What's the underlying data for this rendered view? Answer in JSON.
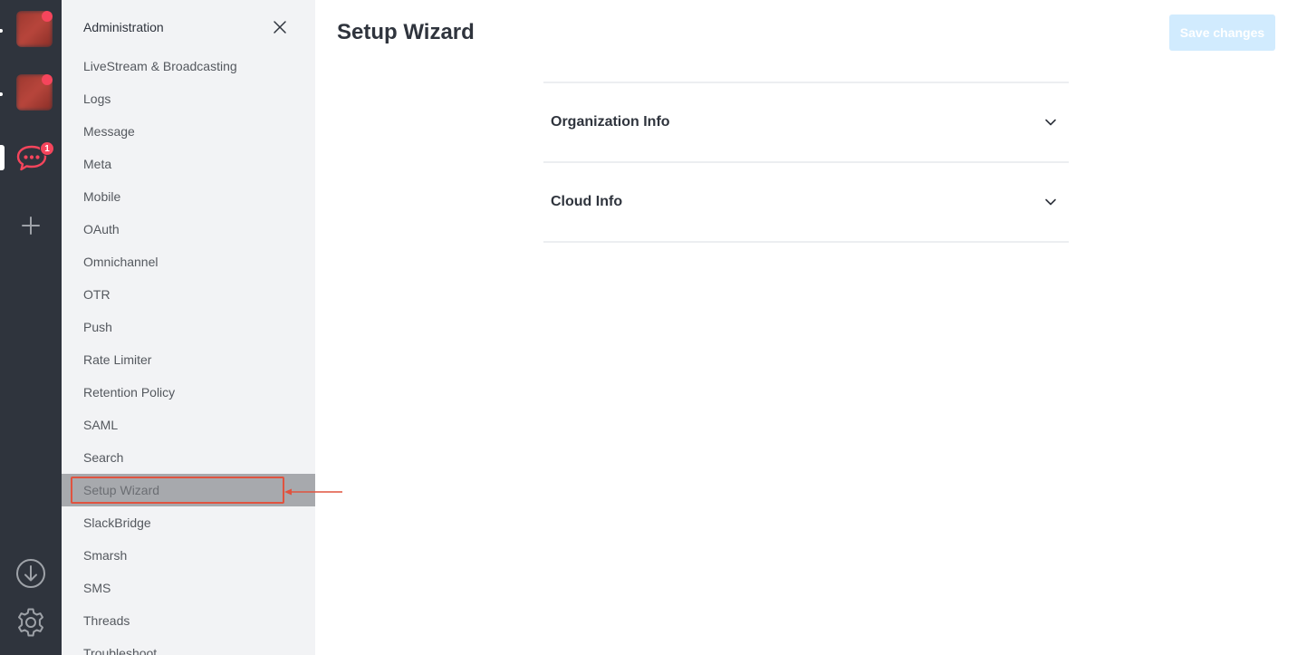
{
  "rail": {
    "notification_badge": "1",
    "icons": [
      "server-avatar",
      "server-avatar",
      "rocketchat-icon",
      "plus-icon",
      "download-icon",
      "gear-icon"
    ]
  },
  "sidebar": {
    "title": "Administration",
    "items": [
      {
        "label": "LiveStream & Broadcasting"
      },
      {
        "label": "Logs"
      },
      {
        "label": "Message"
      },
      {
        "label": "Meta"
      },
      {
        "label": "Mobile"
      },
      {
        "label": "OAuth"
      },
      {
        "label": "Omnichannel"
      },
      {
        "label": "OTR"
      },
      {
        "label": "Push"
      },
      {
        "label": "Rate Limiter"
      },
      {
        "label": "Retention Policy"
      },
      {
        "label": "SAML"
      },
      {
        "label": "Search"
      },
      {
        "label": "Setup Wizard"
      },
      {
        "label": "SlackBridge"
      },
      {
        "label": "Smarsh"
      },
      {
        "label": "SMS"
      },
      {
        "label": "Threads"
      },
      {
        "label": "Troubleshoot"
      }
    ],
    "selected_label": "Setup Wizard"
  },
  "main": {
    "title": "Setup Wizard",
    "save_label": "Save changes",
    "sections": [
      {
        "title": "Organization Info"
      },
      {
        "title": "Cloud Info"
      }
    ]
  },
  "colors": {
    "rail_bg": "#2f343d",
    "sidebar_bg": "#f2f3f5",
    "accent_red": "#f5455c",
    "save_button_disabled": "#d1ebfe",
    "annotation": "#e0533f"
  }
}
